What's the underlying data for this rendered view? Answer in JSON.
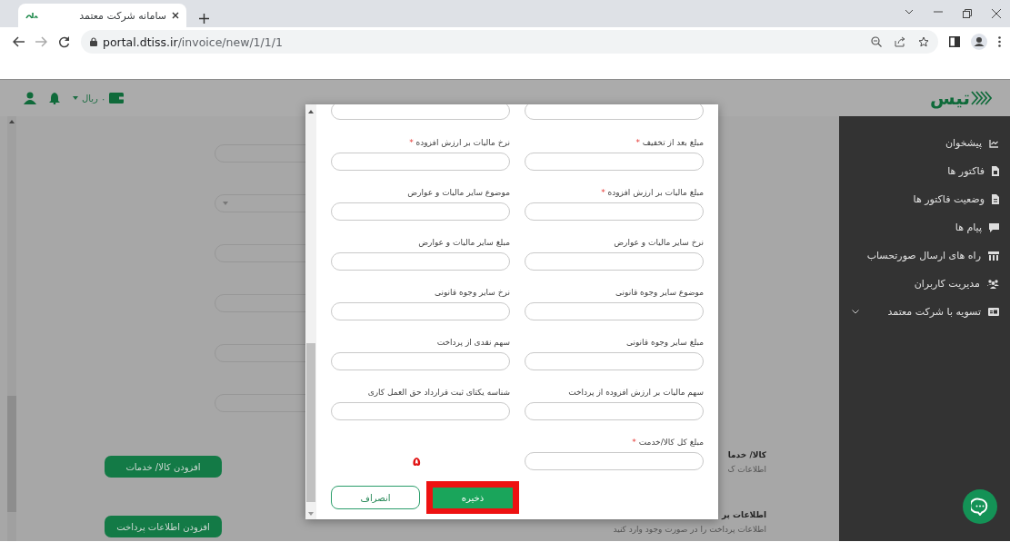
{
  "browser": {
    "tab_title": "سامانه شرکت معتمد",
    "url_host": "portal.dtiss.ir",
    "url_path": "/invoice/new/1/1/1"
  },
  "header": {
    "logo_text": "تیس",
    "currency": "۰ ریال"
  },
  "sidebar": {
    "items": [
      {
        "label": "پیشخوان",
        "kind": "link"
      },
      {
        "label": "فاکتور ها",
        "kind": "link"
      },
      {
        "label": "وضعیت فاکتور ها",
        "kind": "link"
      },
      {
        "label": "پیام ها",
        "kind": "link"
      },
      {
        "label": "راه های ارسال صورتحساب",
        "kind": "link"
      },
      {
        "label": "مدیریت کاربران",
        "kind": "link"
      },
      {
        "label": "تسویه با شرکت معتمد",
        "kind": "group"
      }
    ]
  },
  "background_form": {
    "fields": [
      {
        "kind": "text"
      },
      {
        "kind": "select"
      },
      {
        "kind": "text"
      },
      {
        "kind": "text"
      },
      {
        "kind": "text"
      },
      {
        "kind": "text"
      }
    ],
    "buttons": [
      "افزودن کالا/ خدمات",
      "افزودن اطلاعات پرداخت"
    ],
    "sections": [
      {
        "title": "کالا/ خدما",
        "description": "اطلاعات ک"
      },
      {
        "title": "اطلاعات پر",
        "description": "اطلاعات پرداخت را در صورت وجود وارد کنید"
      }
    ]
  },
  "dialog": {
    "fields": [
      {
        "label": "مبلغ بعد از تخفیف",
        "required": true
      },
      {
        "label": "نرخ مالیات بر ارزش افزوده",
        "required": true
      },
      {
        "label": "مبلغ مالیات بر ارزش افزوده",
        "required": true
      },
      {
        "label": "موضوع سایر مالیات و عوارض",
        "required": false
      },
      {
        "label": "نرخ سایر مالیات و عوارض",
        "required": false
      },
      {
        "label": "مبلغ سایر مالیات و عوارض",
        "required": false
      },
      {
        "label": "موضوع سایر وجوه قانونی",
        "required": false
      },
      {
        "label": "نرخ سایر وجوه قانونی",
        "required": false
      },
      {
        "label": "مبلغ سایر وجوه قانونی",
        "required": false
      },
      {
        "label": "سهم نقدی از پرداخت",
        "required": false
      },
      {
        "label": "سهم مالیات بر ارزش افزوده از پرداخت",
        "required": false
      },
      {
        "label": "شناسه یکتای ثبت قرارداد حق العمل کاری",
        "required": false
      },
      {
        "label": "مبلغ کل کالا/خدمت",
        "required": true
      }
    ],
    "buttons": [
      {
        "label": "ذخیره",
        "kind": "primary",
        "highlighted": true
      },
      {
        "label": "انصراف",
        "kind": "secondary",
        "highlighted": false
      }
    ],
    "required_mark": "*",
    "annotation": "۵"
  }
}
